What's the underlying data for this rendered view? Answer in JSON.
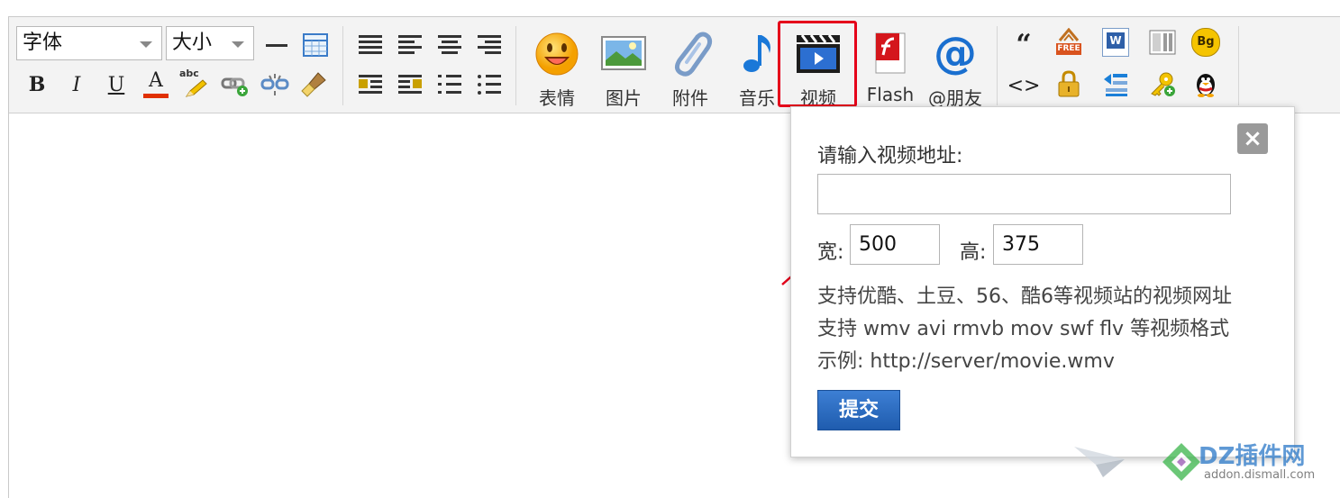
{
  "toolbar": {
    "font_select": "字体",
    "size_select": "大小",
    "big_buttons": [
      {
        "label": "表情",
        "icon": "smiley-icon"
      },
      {
        "label": "图片",
        "icon": "image-icon"
      },
      {
        "label": "附件",
        "icon": "paperclip-icon"
      },
      {
        "label": "音乐",
        "icon": "music-note-icon"
      },
      {
        "label": "视频",
        "icon": "video-clapper-icon"
      },
      {
        "label": "Flash",
        "icon": "flash-icon"
      },
      {
        "label": "@朋友",
        "icon": "at-icon"
      }
    ],
    "format_row1": [
      "bold-icon",
      "italic-icon",
      "underline-icon",
      "font-color-icon",
      "spellcheck-icon",
      "link-icon",
      "unlink-icon",
      "clear-format-icon"
    ],
    "format_glyphs": {
      "bold": "B",
      "italic": "I",
      "underline": "U",
      "font_color": "A",
      "spellcheck": "abc"
    },
    "misc_glyphs": {
      "quote": "“",
      "code": "<>",
      "free": "FREE",
      "qq_free": "Bg",
      "word": "W"
    },
    "highlight_color": "#e5001a"
  },
  "popup": {
    "title": "请输入视频地址:",
    "url_value": "",
    "width_label": "宽:",
    "width_value": "500",
    "height_label": "高:",
    "height_value": "375",
    "help_lines": [
      "支持优酷、土豆、56、酷6等视频站的视频网址",
      "支持 wmv avi rmvb mov swf flv 等视频格式",
      "示例: http://server/movie.wmv"
    ],
    "submit_label": "提交",
    "close_label": "×"
  },
  "watermark": {
    "main_text": "DZ插件网",
    "url_text": "addon.dismall.com"
  }
}
